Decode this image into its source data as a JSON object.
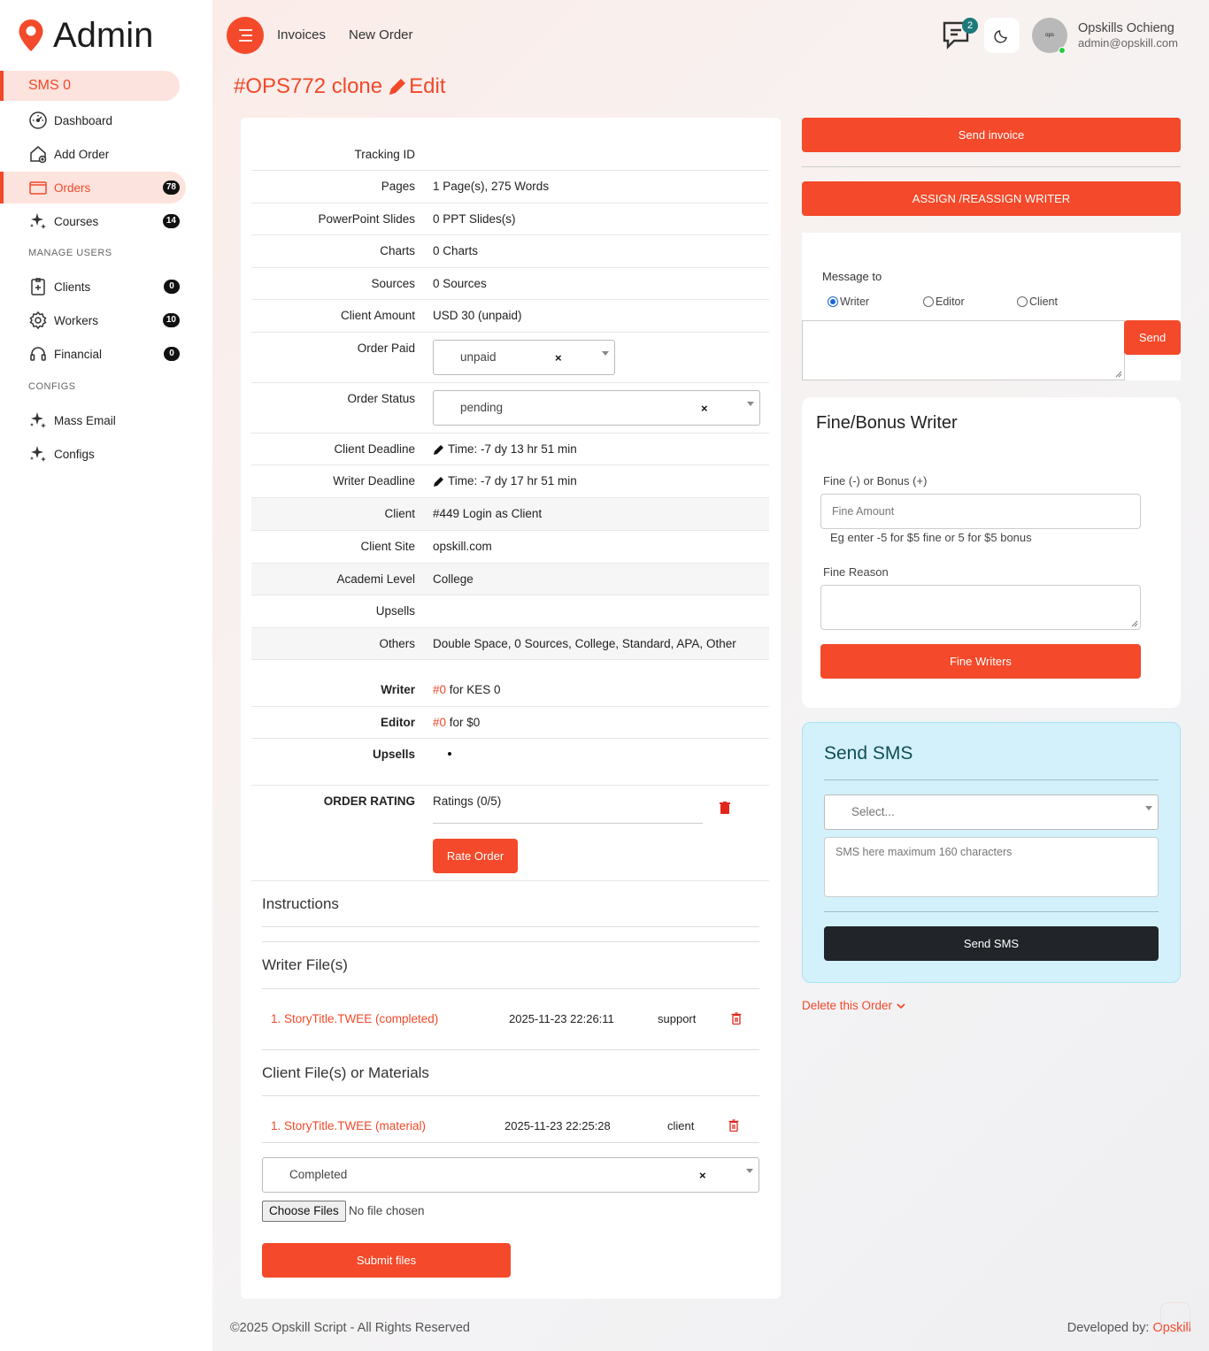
{
  "sidebar": {
    "brand": "Admin",
    "sms": "SMS 0",
    "items": [
      {
        "label": "Dashboard",
        "icon": "dashboard-gauge-icon"
      },
      {
        "label": "Add Order",
        "icon": "home-add-icon"
      },
      {
        "label": "Orders",
        "icon": "orders-box-icon",
        "badge": "78"
      },
      {
        "label": "Courses",
        "icon": "sparkle-icon",
        "badge": "14"
      },
      {
        "label": "Clients",
        "icon": "clipboard-plus-icon",
        "badge": "0"
      },
      {
        "label": "Workers",
        "icon": "gear-icon",
        "badge": "10"
      },
      {
        "label": "Financial",
        "icon": "headset-icon",
        "badge": "0"
      },
      {
        "label": "Mass Email",
        "icon": "sparkle-icon"
      },
      {
        "label": "Configs",
        "icon": "sparkle-icon"
      }
    ],
    "headings": {
      "users": "MANAGE USERS",
      "configs": "CONFIGS"
    }
  },
  "topbar": {
    "links": [
      "Invoices",
      "New Order"
    ],
    "chat_badge": "2",
    "user_name": "Opskills Ochieng",
    "user_email": "admin@opskill.com",
    "avatar_text": "ops"
  },
  "page": {
    "title": "#OPS772 clone",
    "edit": "Edit"
  },
  "details": {
    "tracking": {
      "label": "Tracking ID",
      "value": ""
    },
    "pages": {
      "label": "Pages",
      "value": "1 Page(s), 275 Words"
    },
    "ppt": {
      "label": "PowerPoint Slides",
      "value": "0 PPT Slides(s)"
    },
    "charts": {
      "label": "Charts",
      "value": "0 Charts"
    },
    "sources": {
      "label": "Sources",
      "value": "0 Sources"
    },
    "amount": {
      "label": "Client Amount",
      "value": "USD 30 (unpaid)"
    },
    "paid": {
      "label": "Order Paid",
      "value": "unpaid"
    },
    "status": {
      "label": "Order Status",
      "value": "pending"
    },
    "client_deadline": {
      "label": "Client Deadline",
      "value": "Time: -7 dy 13 hr 51 min"
    },
    "writer_deadline": {
      "label": "Writer Deadline",
      "value": "Time: -7 dy 17 hr 51 min"
    },
    "client": {
      "label": "Client",
      "value": "#449 Login as Client"
    },
    "client_site": {
      "label": "Client Site",
      "value": "opskill.com"
    },
    "level": {
      "label": "Academi Level",
      "value": "College"
    },
    "upsells": {
      "label": "Upsells",
      "value": ""
    },
    "others": {
      "label": "Others",
      "value": "Double Space, 0 Sources, College, Standard, APA, Other"
    },
    "writer": {
      "label": "Writer",
      "id": "#0",
      "rest": " for KES 0"
    },
    "editor": {
      "label": "Editor",
      "id": "#0",
      "rest": " for $0"
    },
    "upsells2": {
      "label": "Upsells"
    },
    "rating": {
      "label": "ORDER RATING",
      "value": "Ratings (0/5)",
      "button": "Rate Order"
    }
  },
  "sections": {
    "instructions": "Instructions",
    "writer_files": "Writer File(s)",
    "client_files": "Client File(s) or Materials"
  },
  "writer_files": [
    {
      "name": "1. StoryTitle.TWEE (completed)",
      "date": "2025-11-23 22:26:11",
      "by": "support"
    }
  ],
  "client_files": [
    {
      "name": "1. StoryTitle.TWEE (material)",
      "date": "2025-11-23 22:25:28",
      "by": "client"
    }
  ],
  "upload": {
    "type": "Completed",
    "choose": "Choose Files",
    "none": "No file chosen",
    "submit": "Submit files"
  },
  "right": {
    "send_invoice": "Send invoice",
    "assign": "ASSIGN /REASSIGN WRITER",
    "message_to": "Message to",
    "radios": [
      "Writer",
      "Editor",
      "Client"
    ],
    "send": "Send",
    "fine_title": "Fine/Bonus Writer",
    "fine_label": "Fine (-) or Bonus (+)",
    "fine_placeholder": "Fine Amount",
    "fine_hint": "Eg enter -5 for $5 fine or 5 for $5 bonus",
    "fine_reason": "Fine Reason",
    "fine_button": "Fine Writers",
    "sms_title": "Send SMS",
    "sms_select": "Select...",
    "sms_placeholder": "SMS here maximum 160 characters",
    "sms_button": "Send SMS",
    "delete": "Delete this Order"
  },
  "footer": {
    "copyright": "©2025 Opskill Script - All Rights Reserved",
    "dev": "Developed by: ",
    "dev_link": "Opskill"
  },
  "colors": {
    "accent": "#f4492a",
    "sms_bg": "#d3f1fa",
    "dark": "#212529"
  }
}
